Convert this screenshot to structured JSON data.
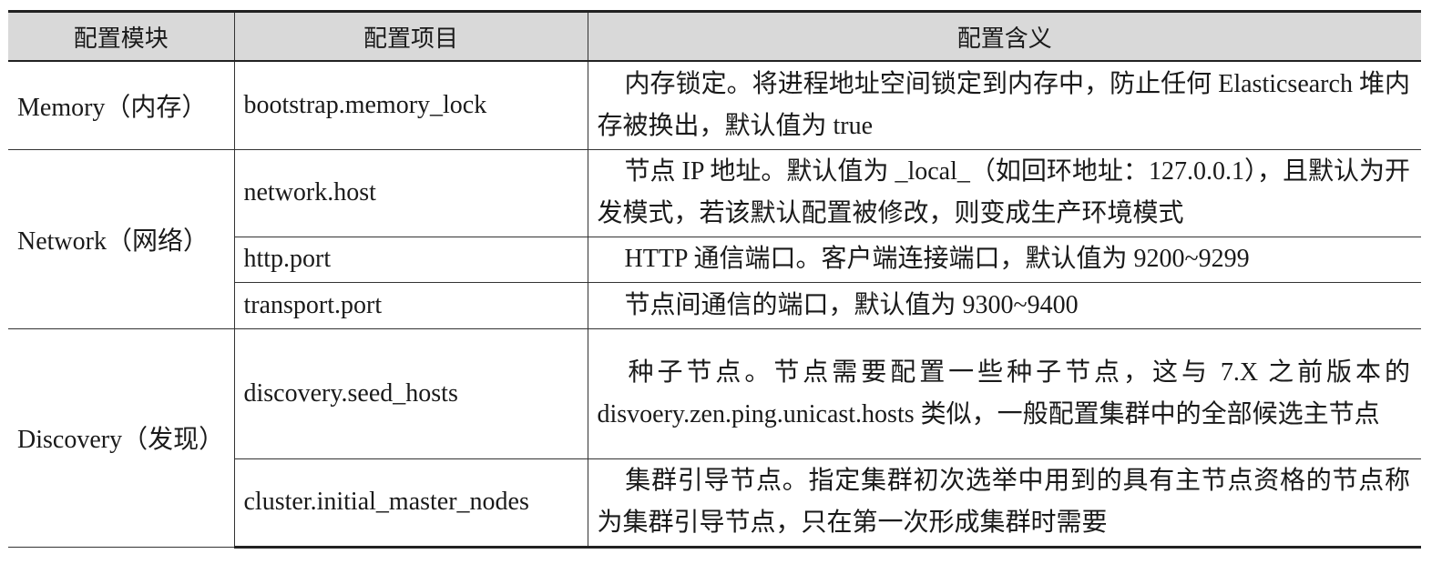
{
  "table": {
    "headers": [
      "配置模块",
      "配置项目",
      "配置含义"
    ],
    "modules": {
      "memory": "Memory（内存）",
      "network": "Network（网络）",
      "discovery": "Discovery（发现）"
    },
    "rows": [
      {
        "item": "bootstrap.memory_lock",
        "meaning": "内存锁定。将进程地址空间锁定到内存中，防止任何 Elasticsearch 堆内存被换出，默认值为 true"
      },
      {
        "item": "network.host",
        "meaning": "节点 IP 地址。默认值为 _local_（如回环地址：127.0.0.1），且默认为开发模式，若该默认配置被修改，则变成生产环境模式"
      },
      {
        "item": "http.port",
        "meaning": "HTTP 通信端口。客户端连接端口，默认值为 9200~9299"
      },
      {
        "item": "transport.port",
        "meaning": "节点间通信的端口，默认值为 9300~9400"
      },
      {
        "item": "discovery.seed_hosts",
        "meaning": "种子节点。节点需要配置一些种子节点，这与 7.X 之前版本的 disvoery.zen.ping.unicast.hosts 类似，一般配置集群中的全部候选主节点"
      },
      {
        "item": "cluster.initial_master_nodes",
        "meaning": "集群引导节点。指定集群初次选举中用到的具有主节点资格的节点称为集群引导节点，只在第一次形成集群时需要"
      }
    ]
  }
}
